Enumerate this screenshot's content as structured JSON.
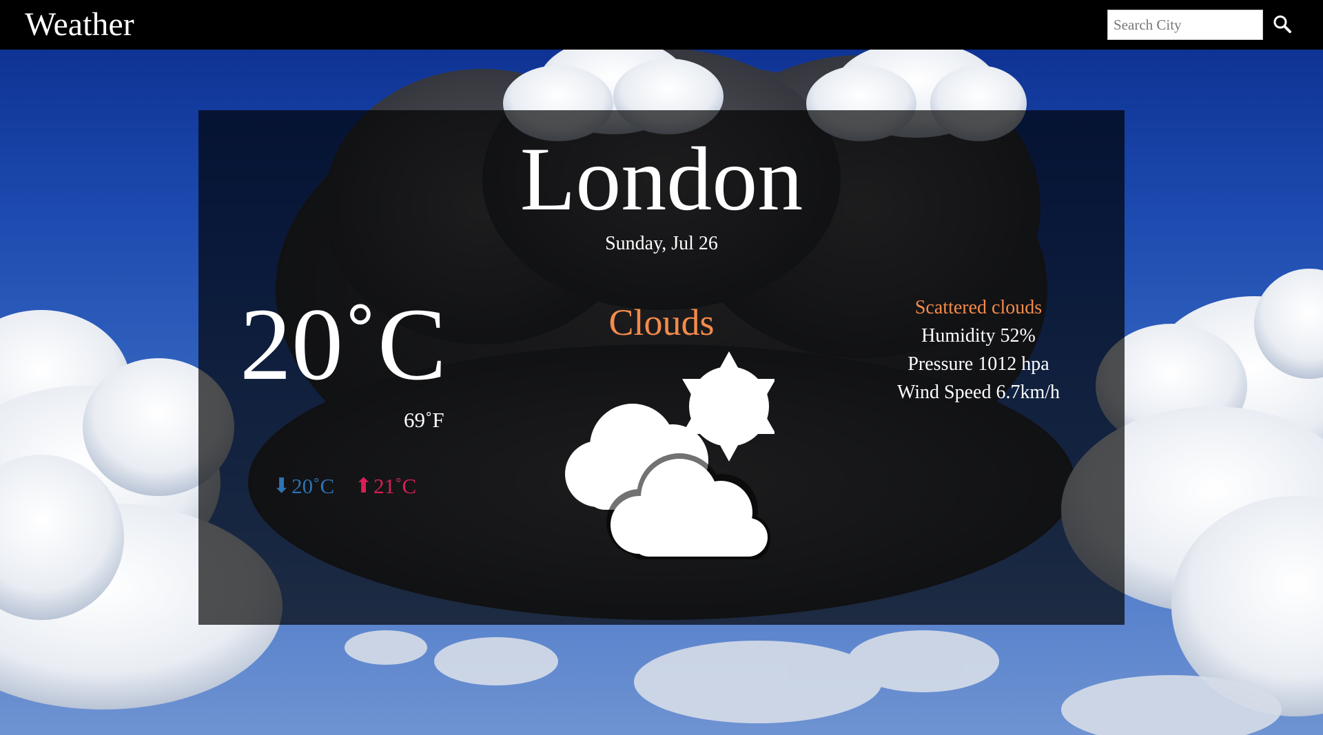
{
  "header": {
    "brand": "Weather",
    "search_placeholder": "Search City",
    "search_icon": "search-icon"
  },
  "weather": {
    "city": "London",
    "date": "Sunday, Jul 26",
    "temp_c": "20˚C",
    "temp_f": "69˚F",
    "temp_min": "20˚C",
    "temp_max": "21˚C",
    "condition": "Clouds",
    "condition_icon": "cloud-sun-icon",
    "description": "Scattered clouds",
    "humidity": "Humidity 52%",
    "pressure": "Pressure 1012 hpa",
    "wind_speed": "Wind Speed 6.7km/h"
  },
  "colors": {
    "accent_orange": "#f58b4b",
    "min_blue": "#2d73b4",
    "max_red": "#d91f55"
  }
}
